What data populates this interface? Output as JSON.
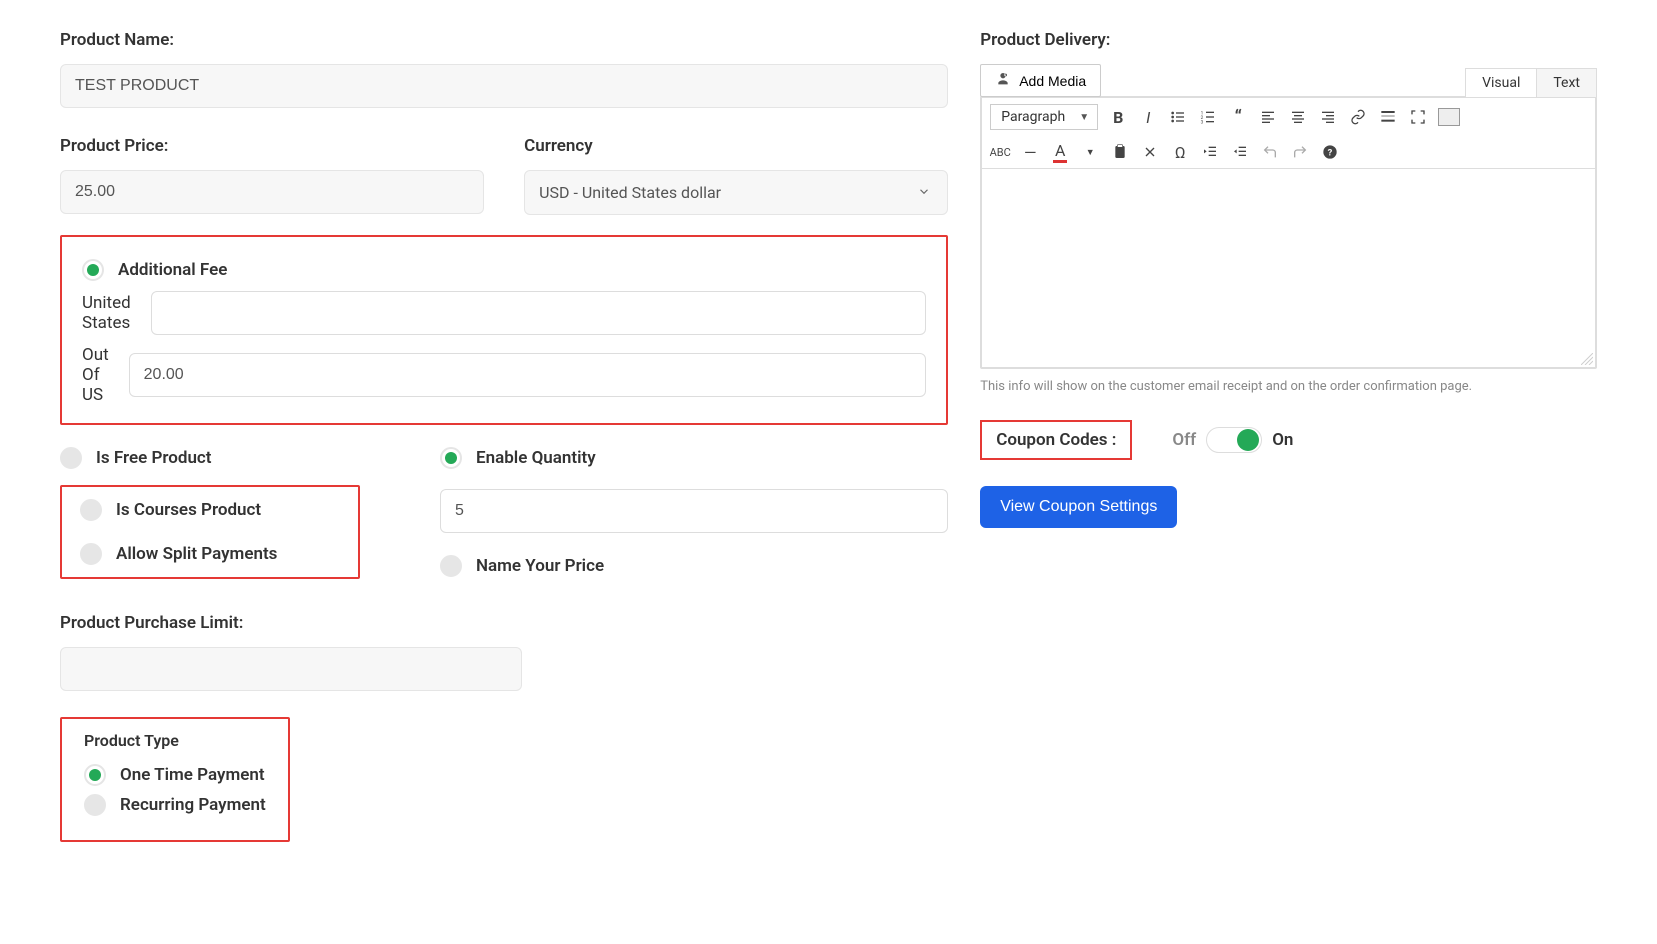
{
  "labels": {
    "product_name": "Product Name:",
    "product_price": "Product Price:",
    "currency": "Currency",
    "additional_fee": "Additional Fee",
    "us": "United States",
    "out_of_us": "Out Of US",
    "is_free": "Is Free Product",
    "is_courses": "Is Courses Product",
    "allow_split": "Allow Split Payments",
    "enable_qty": "Enable Quantity",
    "name_price": "Name Your Price",
    "purchase_limit": "Product Purchase Limit:",
    "product_type": "Product Type",
    "one_time": "One Time Payment",
    "recurring": "Recurring Payment",
    "delivery": "Product Delivery:",
    "add_media": "Add Media",
    "tab_visual": "Visual",
    "tab_text": "Text",
    "format": "Paragraph",
    "hint": "This info will show on the customer email receipt and on the order confirmation page.",
    "coupon": "Coupon Codes :",
    "off": "Off",
    "on": "On",
    "view_coupon": "View Coupon Settings"
  },
  "values": {
    "product_name": "TEST PRODUCT",
    "product_price": "25.00",
    "currency": "USD - United States dollar",
    "fee_us": "",
    "fee_out": "20.00",
    "quantity": "5",
    "purchase_limit": ""
  },
  "state": {
    "additional_fee": true,
    "is_free": false,
    "is_courses": false,
    "allow_split": false,
    "enable_qty": true,
    "name_price": false,
    "one_time": true,
    "recurring": false,
    "coupon_on": true
  },
  "colors": {
    "accent_green": "#24a957",
    "highlight_red": "#e53935",
    "primary_blue": "#1e62e6"
  }
}
